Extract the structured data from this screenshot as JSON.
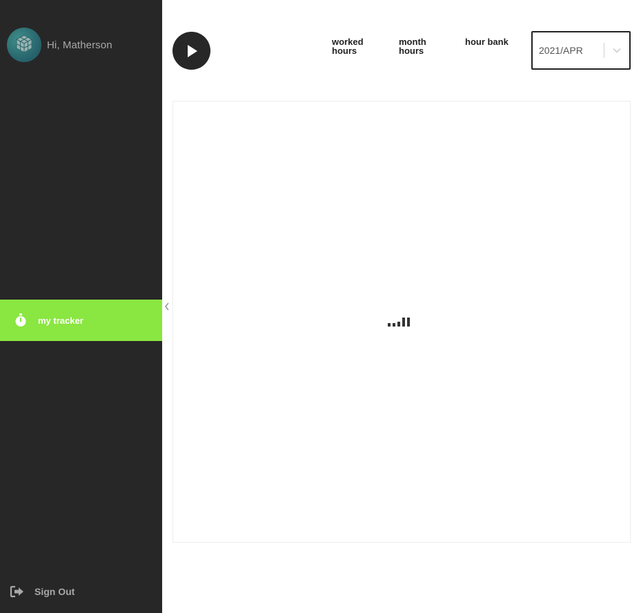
{
  "sidebar": {
    "greeting": "Hi, Matherson",
    "nav": [
      {
        "label": "my tracker",
        "icon": "stopwatch-icon",
        "active": true
      }
    ],
    "signout_label": "Sign Out",
    "active_color": "#8ae641",
    "background": "#272727"
  },
  "header": {
    "stats": [
      {
        "line1": "worked",
        "line2": "hours"
      },
      {
        "line1": "month",
        "line2": "hours"
      },
      {
        "line1": "hour bank",
        "line2": ""
      }
    ],
    "period_select": {
      "value": "2021/APR"
    }
  }
}
